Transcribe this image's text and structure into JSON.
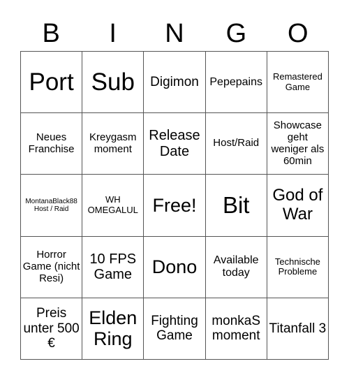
{
  "header": [
    "B",
    "I",
    "N",
    "G",
    "O"
  ],
  "cells": [
    "Port",
    "Sub",
    "Digimon",
    "Pepepains",
    "Remastered Game",
    "Neues Franchise",
    "Kreygasm moment",
    "Release Date",
    "Host/Raid",
    "Showcase geht weniger als 60min",
    "MontanaBlack88 Host / Raid",
    "WH OMEGALUL",
    "Free!",
    "Bit",
    "God of War",
    "Horror Game (nicht Resi)",
    "10 FPS Game",
    "Dono",
    "Available today",
    "Technische Probleme",
    "Preis unter 500 €",
    "Elden Ring",
    "Fighting Game",
    "monkaS moment",
    "Titanfall 3"
  ]
}
